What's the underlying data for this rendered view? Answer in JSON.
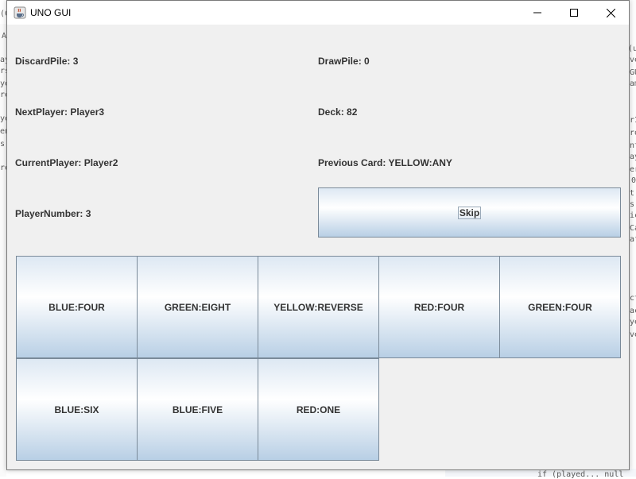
{
  "window": {
    "title": "UNO GUI",
    "icon": "java-coffee-icon"
  },
  "game": {
    "discard_pile": "DiscardPile: 3",
    "draw_pile": "DrawPile: 0",
    "next_player": "NextPlayer: Player3",
    "deck": "Deck: 82",
    "current_player": "CurrentPlayer: Player2",
    "previous_card": "Previous Card: YELLOW:ANY",
    "player_number": "PlayerNumber: 3",
    "skip_label": "Skip"
  },
  "hand": [
    "BLUE:FOUR",
    "GREEN:EIGHT",
    "YELLOW:REVERSE",
    "RED:FOUR",
    "GREEN:FOUR",
    "BLUE:SIX",
    "BLUE:FIVE",
    "RED:ONE"
  ],
  "background": {
    "code_left": [
      "(C",
      "A",
      "ay",
      "rs",
      "ye",
      "re",
      "ye",
      "en",
      "s",
      "re"
    ],
    "code_right": [
      "(u",
      "ve",
      "GU",
      "am",
      "rI",
      "ro",
      "nt",
      "ay",
      "er",
      "0",
      "t",
      "s[",
      "ic",
      "Ca",
      "af",
      "ct",
      "ac",
      "ye",
      "ve"
    ],
    "code_bottom": "if (played... null"
  },
  "colors": {
    "window_bg": "#f0f0f0",
    "button_border": "#7a8a99",
    "text": "#333333"
  }
}
